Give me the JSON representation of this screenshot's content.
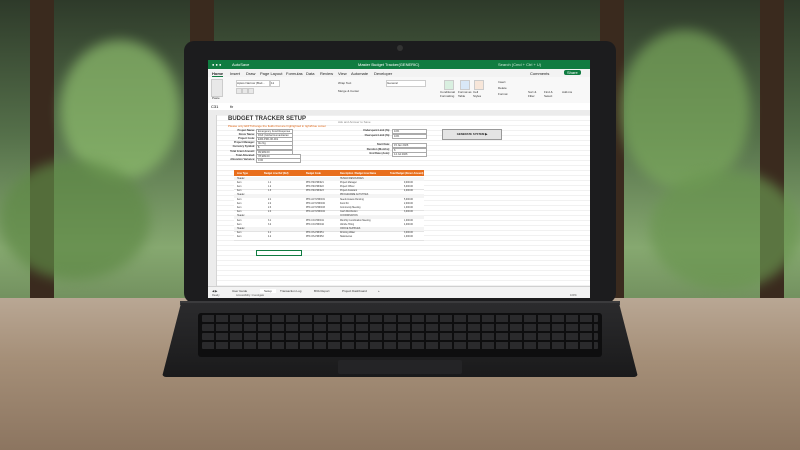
{
  "window": {
    "autosave_label": "AutoSave",
    "doc_title": "Master Budget Tracker(GENERIC)",
    "search_placeholder": "Search (Cmd + Ctrl + U)",
    "comments_label": "Comments",
    "share_label": "Share"
  },
  "menu": [
    "Home",
    "Insert",
    "Draw",
    "Page Layout",
    "Formulas",
    "Data",
    "Review",
    "View",
    "Automate",
    "Developer"
  ],
  "ribbon": {
    "font_name": "Aptos Narrow (Bod...",
    "font_size": "11",
    "number_format": "General",
    "wrap_text": "Wrap Text",
    "merge_center": "Merge & Center",
    "conditional": "Conditional Formatting",
    "format_table": "Format as Table",
    "cell_styles": "Cell Styles",
    "insert": "Insert",
    "delete": "Delete",
    "format": "Format",
    "sort_filter": "Sort & Filter",
    "find_select": "Find & Select",
    "addins": "Add-ins",
    "paste": "Paste"
  },
  "formula_bar": {
    "cell_ref": "C31",
    "fx": "fx"
  },
  "sheet": {
    "title": "BUDGET TRACKER SETUP",
    "subtitle": "Please only EDIT/change the fields that are highlighted in light/blue colour",
    "note": "Ask and Answer to Save",
    "fields": [
      {
        "label": "Project Name:",
        "value": "Emergency Food Response"
      },
      {
        "label": "Donor Name:",
        "value": "DGF (Global Humanitarian Fund)"
      },
      {
        "label": "Project Code:",
        "value": "EFR-PRF-06-001"
      },
      {
        "label": "Project Manager:",
        "value": "Ibo Ng"
      },
      {
        "label": "Currency Symbol:",
        "value": "$"
      },
      {
        "label": "Total Grant Amount:",
        "value": "99,999.00"
      },
      {
        "label": "Total Allocated:",
        "value": "78,999.00"
      },
      {
        "label": "Allocation Variance:",
        "value": "0.00"
      }
    ],
    "right_fields": [
      {
        "label": "Underspent Limit (%):",
        "value": "10%"
      },
      {
        "label": "Overspent Limit (%):",
        "value": "10%"
      },
      {
        "label": "Start Date:",
        "value": "15 Jan 2026"
      },
      {
        "label": "Duration (Months):",
        "value": "6"
      },
      {
        "label": "End Date (Auto):",
        "value": "14 Jul 2026"
      }
    ],
    "generate_button": "GENERATE SYSTEM ▶",
    "table_headers": [
      "Line Type",
      "Budget Line Ref (Ref)",
      "Budget Code",
      "Description / Budget Line Name",
      "Total Budget (Donor Amount)"
    ],
    "table_rows": [
      {
        "type": "Header",
        "ref": "",
        "code": "",
        "desc": "HUMAN RESOURCES",
        "amount": ""
      },
      {
        "type": "Item",
        "ref": "1.1",
        "code": "PPF-HR-PRF021",
        "desc": "Project Manager",
        "amount": "9,000.00"
      },
      {
        "type": "Item",
        "ref": "1.2",
        "code": "PPF-HR-PRF022",
        "desc": "Project Officer",
        "amount": "6,000.00"
      },
      {
        "type": "Item",
        "ref": "1.3",
        "code": "PPF-HR-PRF023",
        "desc": "Project Assistant",
        "amount": "4,000.00"
      },
      {
        "type": "Header",
        "ref": "",
        "code": "",
        "desc": "PROGRAMME ACTIVITIES",
        "amount": ""
      },
      {
        "type": "Item",
        "ref": "2.1",
        "code": "PPF-ACT-PRF031",
        "desc": "Needs Assess Running",
        "amount": "5,000.00"
      },
      {
        "type": "Item",
        "ref": "2.2",
        "code": "PPF-ACT-PRF032",
        "desc": "Food Kit",
        "amount": "2,000.00"
      },
      {
        "type": "Item",
        "ref": "2.3",
        "code": "PPF-ACT-PRF033",
        "desc": "Community Meeting",
        "amount": "1,000.00"
      },
      {
        "type": "Item",
        "ref": "2.4",
        "code": "PPF-ACT-PRF034",
        "desc": "Cash Distribution",
        "amount": "3,000.00"
      },
      {
        "type": "Header",
        "ref": "",
        "code": "",
        "desc": "COORDINATION",
        "amount": ""
      },
      {
        "type": "Item",
        "ref": "3.1",
        "code": "PPF-CO-PRF041",
        "desc": "Monthly Coordination Meeting",
        "amount": "1,000.00"
      },
      {
        "type": "Item",
        "ref": "3.2",
        "code": "PPF-CO-PRF042",
        "desc": "Vehicle Hiring",
        "amount": "4,000.00"
      },
      {
        "type": "Header",
        "ref": "",
        "code": "",
        "desc": "OFFICE SUPPLIES",
        "amount": ""
      },
      {
        "type": "Item",
        "ref": "4.1",
        "code": "PPF-OS-PRF051",
        "desc": "Drinking Water",
        "amount": "3,000.00"
      },
      {
        "type": "Item",
        "ref": "4.2",
        "code": "PPF-OS-PRF052",
        "desc": "Stationeries",
        "amount": "1,000.00"
      }
    ]
  },
  "tabs": [
    "User Guide",
    "Setup",
    "Transaction Log",
    "BVA Report",
    "Project Dashboard"
  ],
  "status": {
    "ready": "Ready",
    "accessibility": "Accessibility: Investigate",
    "zoom": "100%"
  },
  "colors": {
    "excel_green": "#107c41",
    "header_orange": "#e86e1c"
  }
}
